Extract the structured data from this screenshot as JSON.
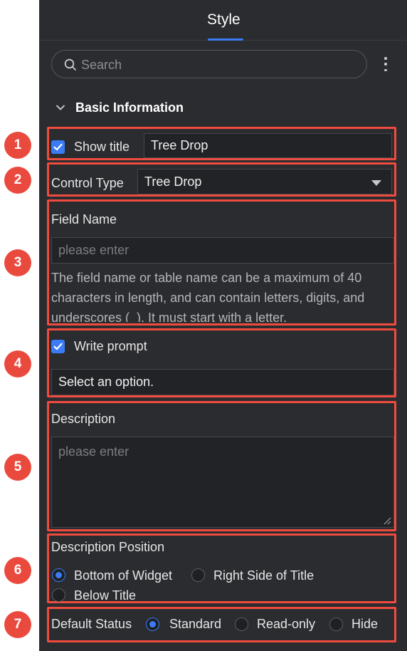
{
  "header": {
    "tab_label": "Style"
  },
  "search": {
    "placeholder": "Search"
  },
  "section": {
    "title": "Basic Information"
  },
  "show_title": {
    "checkbox_label": "Show title",
    "checked": true,
    "value": "Tree Drop"
  },
  "control_type": {
    "label": "Control Type",
    "value": "Tree Drop"
  },
  "field_name": {
    "label": "Field Name",
    "placeholder": "please enter",
    "help": "The field name or table name can be a maximum of 40 characters in length, and can contain letters, digits, and underscores (_). It must start with a letter."
  },
  "write_prompt": {
    "checkbox_label": "Write prompt",
    "checked": true,
    "value": "Select an option."
  },
  "description": {
    "label": "Description",
    "placeholder": "please enter"
  },
  "description_position": {
    "label": "Description Position",
    "options": [
      "Bottom of Widget",
      "Right Side of Title",
      "Below Title"
    ],
    "selected": "Bottom of Widget"
  },
  "default_status": {
    "label": "Default Status",
    "options": [
      "Standard",
      "Read-only",
      "Hide"
    ],
    "selected": "Standard"
  },
  "markers": [
    "1",
    "2",
    "3",
    "4",
    "5",
    "6",
    "7"
  ],
  "colors": {
    "accent": "#3b7cf6",
    "highlight": "#f04b3f",
    "panel_bg": "#2b2c2f"
  }
}
